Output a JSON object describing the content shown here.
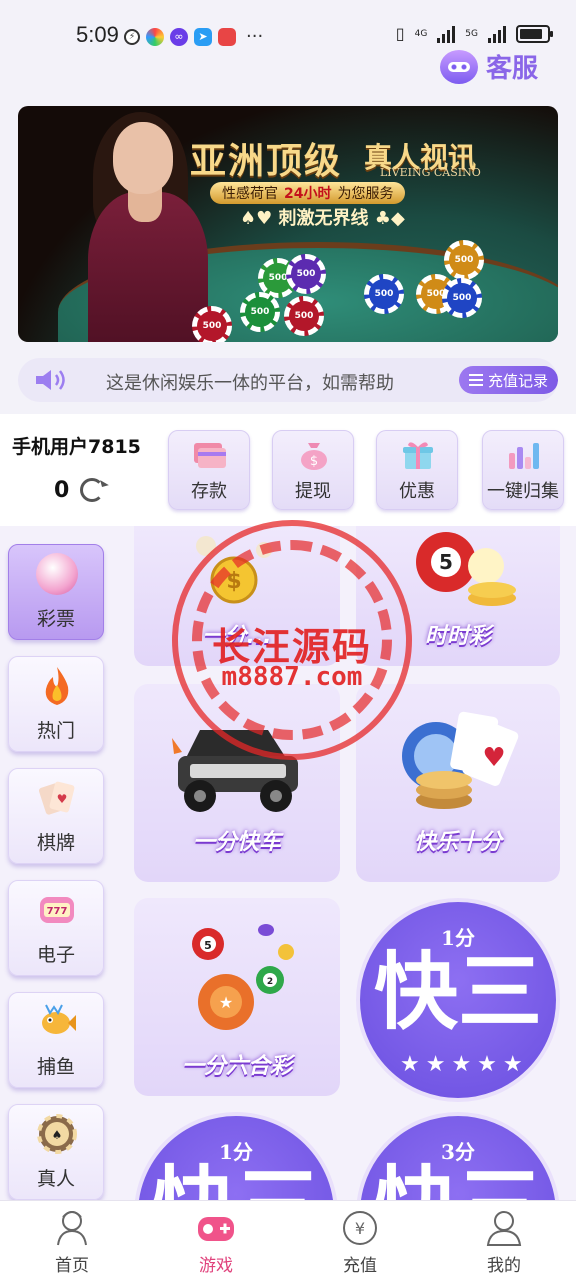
{
  "status_bar": {
    "time": "5:09",
    "more": "···",
    "net_a": "4G",
    "net_b": "5G"
  },
  "header": {
    "service_label": "客服"
  },
  "banner": {
    "title": "亚洲顶级",
    "title_b": "真人视讯",
    "subtitle_en": "LIVEING CASINO",
    "pill_a": "性感荷官",
    "pill_b": "24小时",
    "pill_c": "为您服务",
    "slogan": "♠♥ 刺激无界线 ♣◆",
    "chip_label": "500"
  },
  "notice": {
    "text": "这是休闲娱乐一体的平台，如需帮助",
    "button_label": "充值记录"
  },
  "user": {
    "name": "手机用户7815",
    "balance": "0"
  },
  "actions": [
    {
      "label": "存款",
      "icon": "card-icon"
    },
    {
      "label": "提现",
      "icon": "money-bag-icon"
    },
    {
      "label": "优惠",
      "icon": "gift-icon"
    },
    {
      "label": "一键归集",
      "icon": "bar-chart-icon"
    }
  ],
  "categories": [
    {
      "label": "彩票",
      "icon": "lottery-ball-icon",
      "active": true
    },
    {
      "label": "热门",
      "icon": "fire-icon"
    },
    {
      "label": "棋牌",
      "icon": "cards-icon"
    },
    {
      "label": "电子",
      "icon": "slot-icon"
    },
    {
      "label": "捕鱼",
      "icon": "fish-icon"
    },
    {
      "label": "真人",
      "icon": "chip-icon"
    }
  ],
  "games": {
    "g1": "一分...",
    "g2": "时时彩",
    "g3": "一分快车",
    "g4": "快乐十分",
    "g5": "一分六合彩",
    "g6_top": "1分",
    "g6_big": "快三",
    "g7_top": "1分",
    "g7_big": "快三",
    "g8_top": "3分",
    "g8_big": "快三"
  },
  "watermark": {
    "title": "长汪源码",
    "url": "m8887.com"
  },
  "bottom_nav": [
    {
      "label": "首页",
      "icon": "home-icon"
    },
    {
      "label": "游戏",
      "icon": "gamepad-icon",
      "active": true
    },
    {
      "label": "充值",
      "icon": "yuan-coin-icon"
    },
    {
      "label": "我的",
      "icon": "user-icon"
    }
  ],
  "colors": {
    "accent": "#8a66e8",
    "active_nav": "#e0427c",
    "page_bg": "#f3f2f9"
  }
}
